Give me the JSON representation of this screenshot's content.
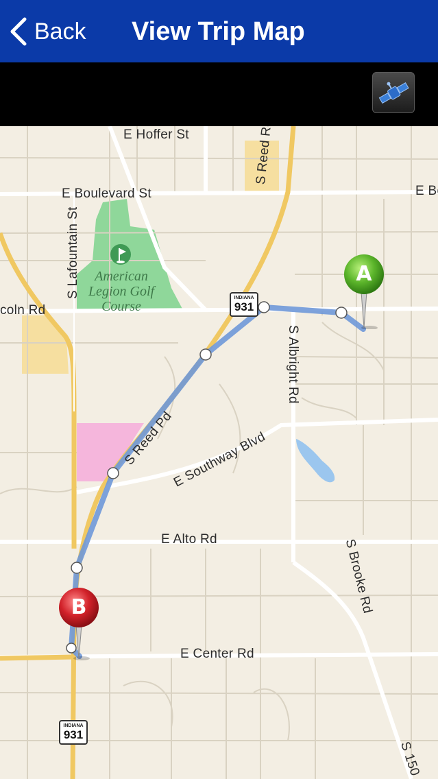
{
  "nav": {
    "back_label": "Back",
    "title": "View Trip Map"
  },
  "toolbar": {
    "map_type_icon": "satellite-icon"
  },
  "map": {
    "streets": {
      "hoffer": "E Hoffer St",
      "boulevard": "E Boulevard St",
      "boulevard_right": "E Bo",
      "reed": "S Reed Rd",
      "lafountain": "S Lafountain St",
      "lincoln": "coln Rd",
      "albright": "S Albright Rd",
      "southway": "E Southway Blvd",
      "alto": "E Alto Rd",
      "brooke": "S Brooke Rd",
      "center": "E Center Rd",
      "reed_pd": "S Reed Pd",
      "s150": "S 150"
    },
    "golf_course": "American Legion Golf Course",
    "golf_course_lines": [
      "American",
      "Legion Golf",
      "Course"
    ],
    "shields": [
      {
        "state": "INDIANA",
        "number": "931"
      },
      {
        "state": "INDIANA",
        "number": "931"
      }
    ],
    "pins": {
      "start": {
        "letter": "A",
        "color": "#5cb52b"
      },
      "end": {
        "letter": "B",
        "color": "#d2222a"
      }
    },
    "route_color": "#6f98d8"
  }
}
